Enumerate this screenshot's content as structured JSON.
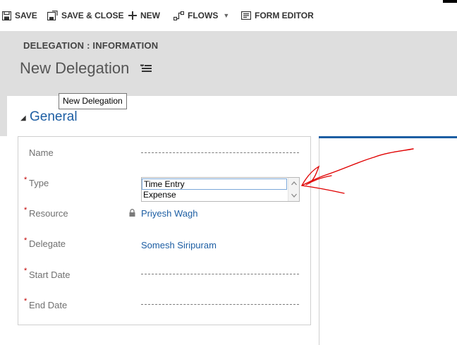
{
  "toolbar": {
    "save_label": "SAVE",
    "save_close_label": "SAVE & CLOSE",
    "new_label": "NEW",
    "flows_label": "FLOWS",
    "form_editor_label": "FORM EDITOR"
  },
  "header": {
    "entity_label": "DELEGATION : INFORMATION",
    "record_title": "New Delegation"
  },
  "tooltip": {
    "text": "New Delegation"
  },
  "section": {
    "title": "General"
  },
  "fields": {
    "name": {
      "label": "Name"
    },
    "type": {
      "label": "Type",
      "options": [
        "Time Entry",
        "Expense"
      ]
    },
    "resource": {
      "label": "Resource",
      "value": "Priyesh Wagh"
    },
    "delegate": {
      "label": "Delegate",
      "value": "Somesh Siripuram"
    },
    "start_date": {
      "label": "Start Date"
    },
    "end_date": {
      "label": "End Date"
    },
    "required_marker": "*"
  },
  "colors": {
    "accent": "#1d5ea3",
    "header_bg": "#dedede",
    "required": "#c00000",
    "annotation": "#e00000"
  }
}
